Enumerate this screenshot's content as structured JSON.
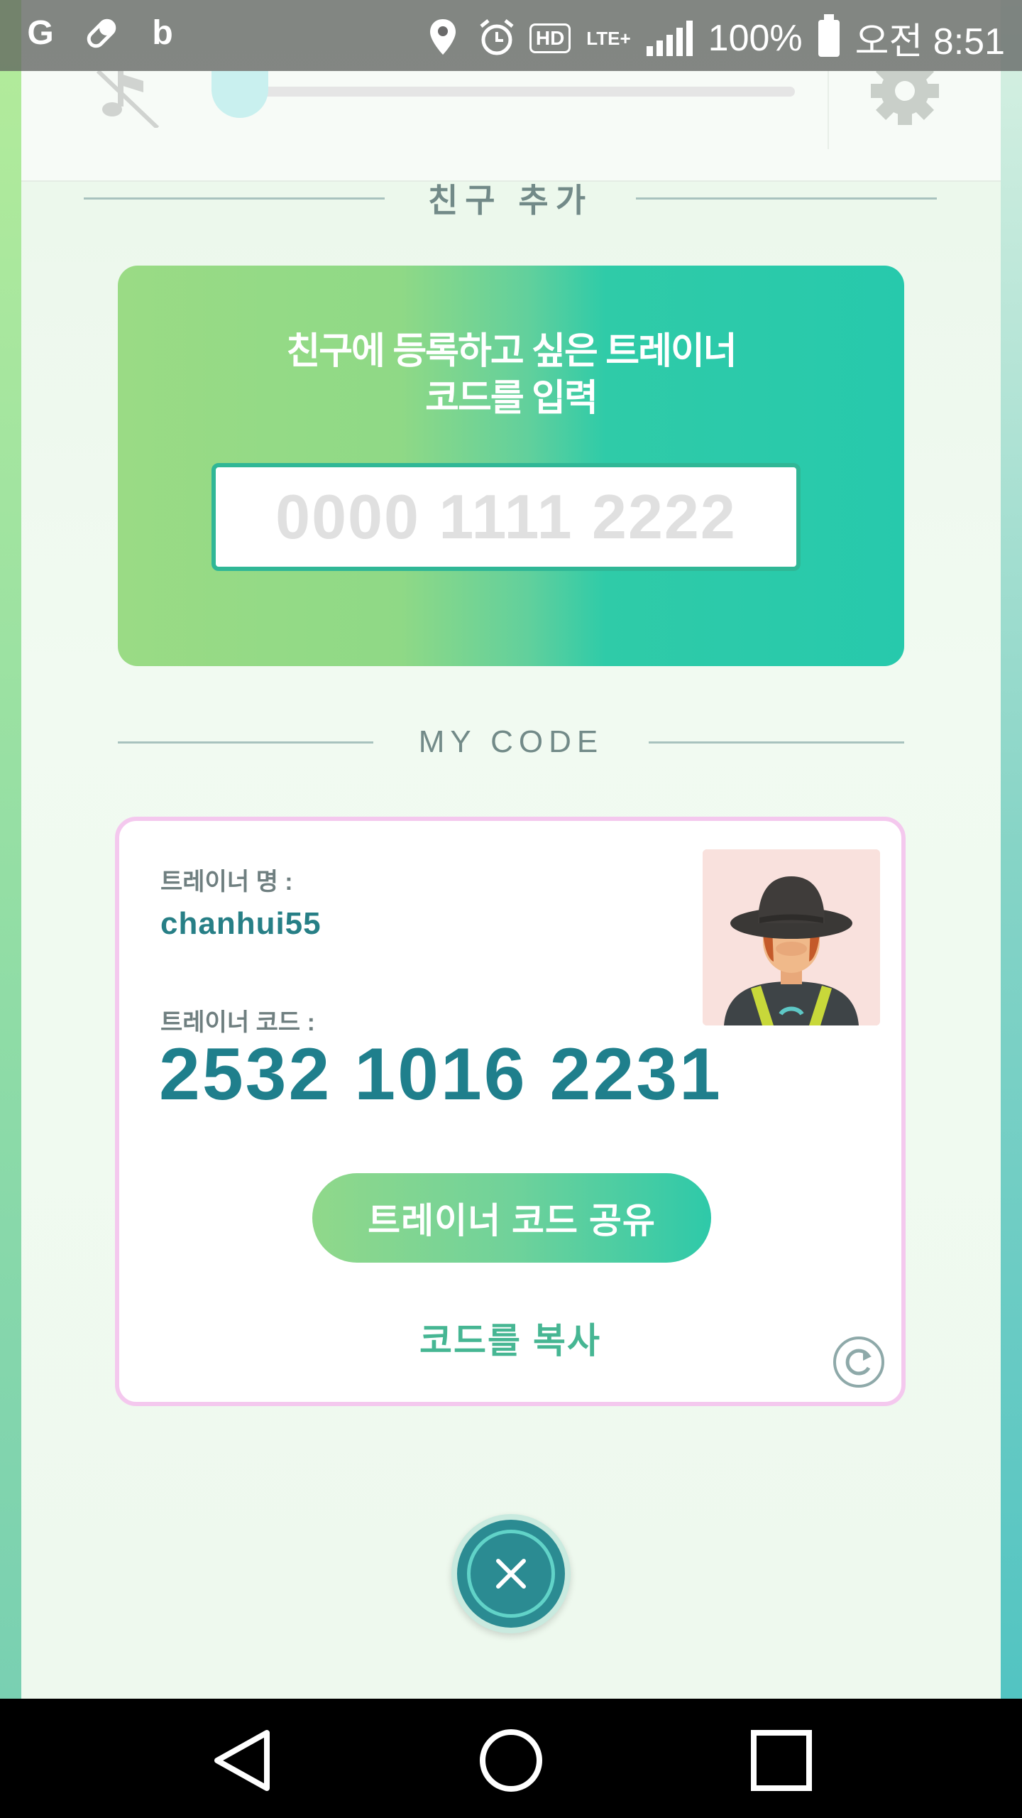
{
  "status_bar": {
    "left_icons": [
      "g-app-icon",
      "pill-icon",
      "b-app-icon"
    ],
    "battery": "100%",
    "time": "오전 8:51",
    "hd": "HD",
    "network": "LTE+"
  },
  "top_bar": {
    "music_icon": "music-off-icon",
    "settings_icon": "gear-icon",
    "volume_level": 0.0
  },
  "add_friend": {
    "heading": "친구 추가",
    "prompt_line1": "친구에 등록하고 싶은 트레이너",
    "prompt_line2": "코드를 입력",
    "input_placeholder": "0000 1111 2222"
  },
  "my_code": {
    "heading": "MY CODE",
    "name_label": "트레이너 명 :",
    "name_value": "chanhui55",
    "code_label": "트레이너 코드 :",
    "code_value": "2532 1016 2231",
    "share_label": "트레이너 코드 공유",
    "copy_label": "코드를 복사"
  },
  "colors": {
    "accent_teal": "#1f7f8c",
    "card_border": "#f4c8ee",
    "button_green": "#2ec9a9"
  }
}
